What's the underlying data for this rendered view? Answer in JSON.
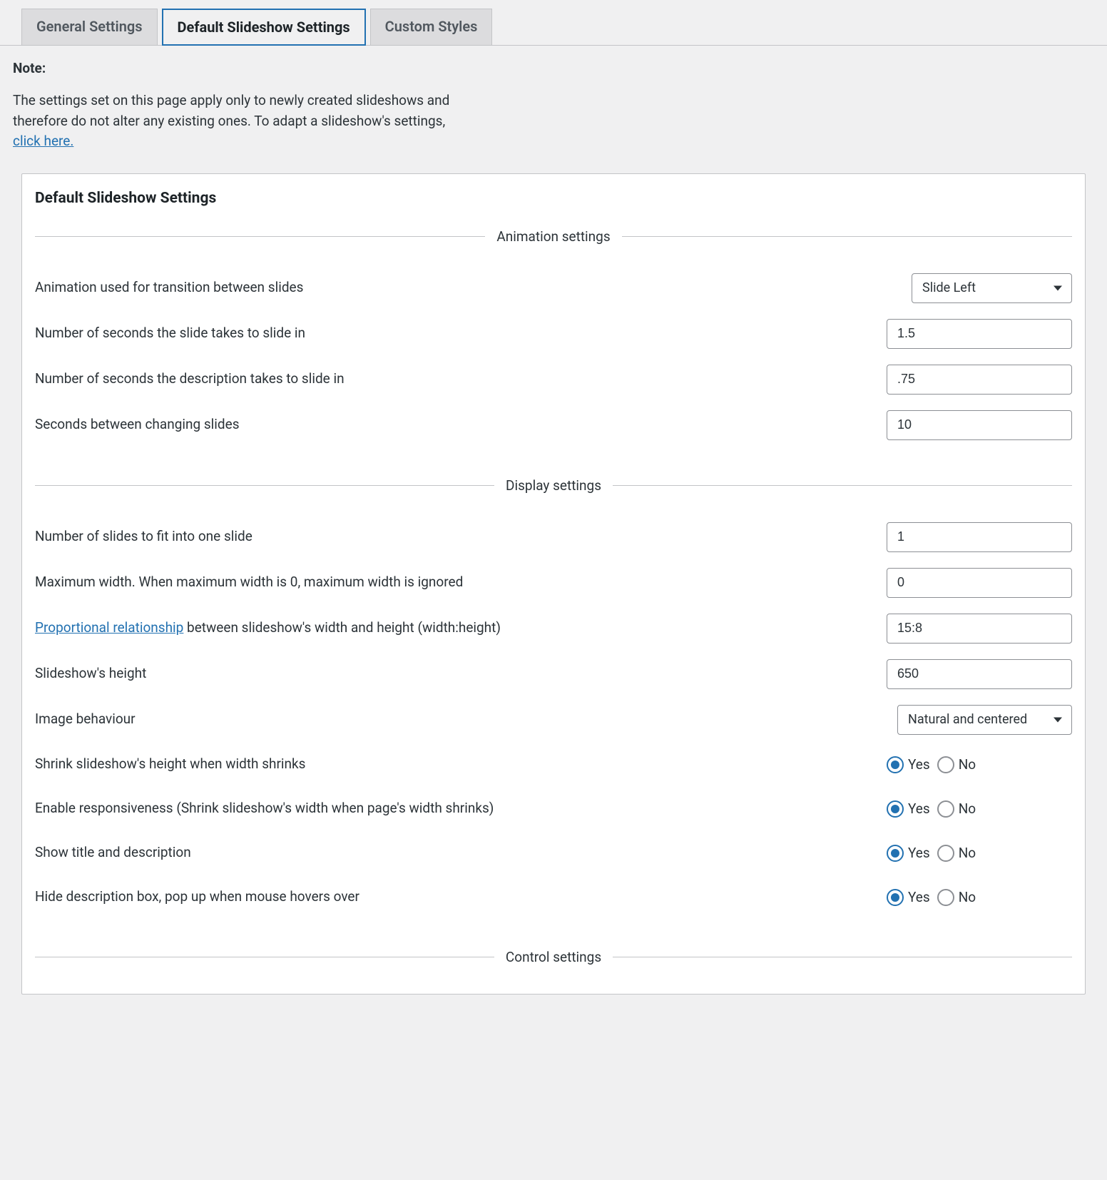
{
  "tabs": {
    "general": "General Settings",
    "default": "Default Slideshow Settings",
    "custom": "Custom Styles"
  },
  "note": {
    "label": "Note:",
    "text": "The settings set on this page apply only to newly created slideshows and therefore do not alter any existing ones. To adapt a slideshow's settings, ",
    "link": "click here."
  },
  "panel": {
    "title": "Default Slideshow Settings"
  },
  "sections": {
    "animation": "Animation settings",
    "display": "Display settings",
    "control": "Control settings"
  },
  "animation": {
    "transition_label": "Animation used for transition between slides",
    "transition_value": "Slide Left",
    "slide_seconds_label": "Number of seconds the slide takes to slide in",
    "slide_seconds_value": "1.5",
    "desc_seconds_label": "Number of seconds the description takes to slide in",
    "desc_seconds_value": ".75",
    "between_label": "Seconds between changing slides",
    "between_value": "10"
  },
  "display": {
    "num_slides_label": "Number of slides to fit into one slide",
    "num_slides_value": "1",
    "max_width_label": "Maximum width. When maximum width is 0, maximum width is ignored",
    "max_width_value": "0",
    "proportional_link": "Proportional relationship",
    "proportional_rest": " between slideshow's width and height (width:height)",
    "proportional_value": "15:8",
    "height_label": "Slideshow's height",
    "height_value": "650",
    "image_behaviour_label": "Image behaviour",
    "image_behaviour_value": "Natural and centered",
    "shrink_height_label": "Shrink slideshow's height when width shrinks",
    "responsiveness_label": "Enable responsiveness (Shrink slideshow's width when page's width shrinks)",
    "show_title_label": "Show title and description",
    "hide_desc_label": "Hide description box, pop up when mouse hovers over"
  },
  "radio": {
    "yes": "Yes",
    "no": "No"
  }
}
